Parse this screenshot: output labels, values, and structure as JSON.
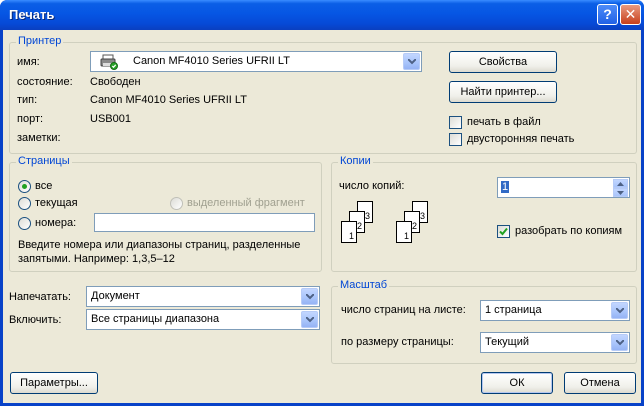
{
  "window": {
    "title": "Печать",
    "help_glyph": "?",
    "close_glyph": "✕"
  },
  "printer": {
    "legend": "Принтер",
    "name_label": "имя:",
    "name_value": "Canon MF4010 Series UFRII LT",
    "status_label": "состояние:",
    "status_value": "Свободен",
    "type_label": "тип:",
    "type_value": "Canon MF4010 Series UFRII LT",
    "port_label": "порт:",
    "port_value": "USB001",
    "notes_label": "заметки:",
    "properties_button": "Свойства",
    "find_printer_button": "Найти принтер...",
    "print_to_file": "печать в файл",
    "duplex": "двусторонняя печать"
  },
  "pages": {
    "legend": "Страницы",
    "all": "все",
    "current": "текущая",
    "selection": "выделенный фрагмент",
    "pages_option": "номера:",
    "hint": "Введите номера или диапазоны страниц, разделенные запятыми. Например: 1,3,5–12",
    "selected": "all"
  },
  "copies": {
    "legend": "Копии",
    "count_label": "число копий:",
    "count_value": "1",
    "collate_label": "разобрать по копиям",
    "collate_checked": true,
    "page_glyphs": [
      "3",
      "2",
      "1",
      "3",
      "2",
      "1"
    ]
  },
  "print_what": {
    "label": "Напечатать:",
    "value": "Документ"
  },
  "include": {
    "label": "Включить:",
    "value": "Все страницы диапазона"
  },
  "zoom": {
    "legend": "Масштаб",
    "pages_per_sheet_label": "число страниц на листе:",
    "pages_per_sheet_value": "1 страница",
    "scale_label": "по размеру страницы:",
    "scale_value": "Текущий"
  },
  "footer": {
    "options_button": "Параметры...",
    "ok_button": "ОК",
    "cancel_button": "Отмена"
  },
  "colors": {
    "title_bar": "#0656e4",
    "dialog_bg": "#ece9d8",
    "legend_text": "#0046d5",
    "radio_dot": "#21a121",
    "check_mark": "#21a121"
  }
}
